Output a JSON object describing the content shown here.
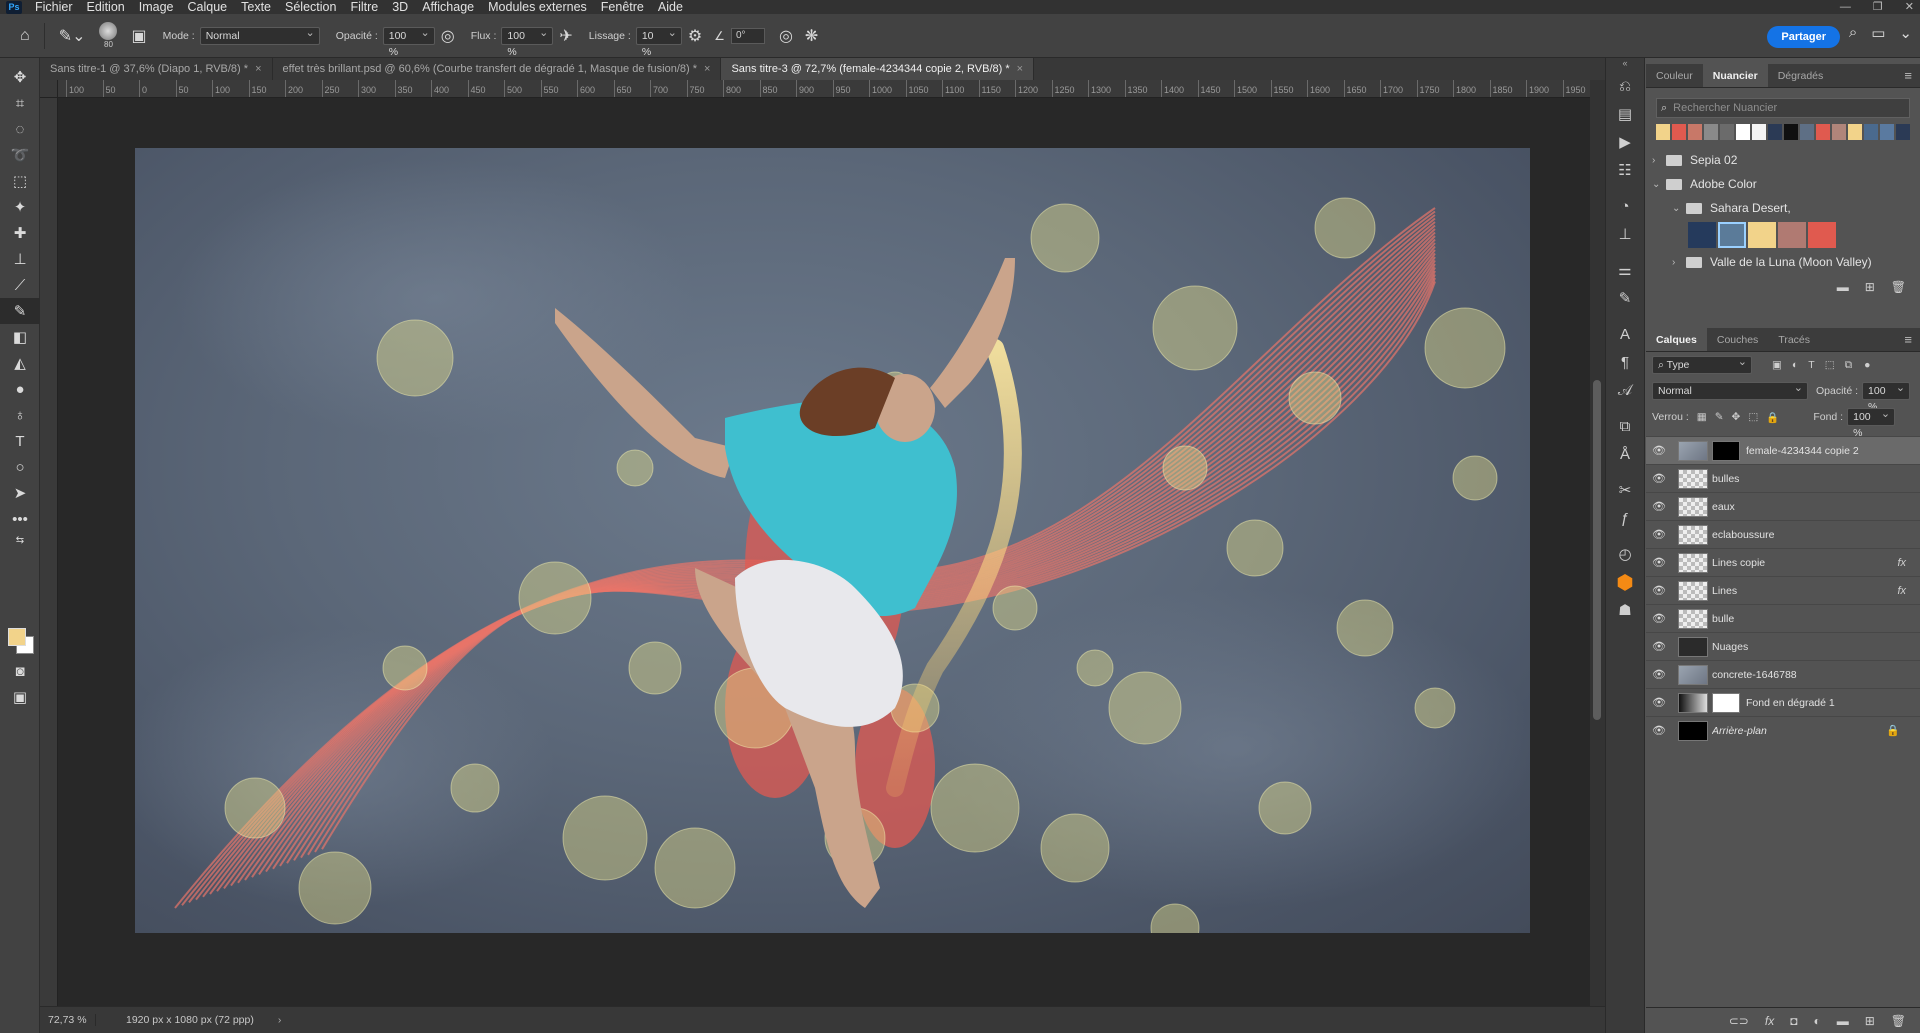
{
  "menu": [
    "Fichier",
    "Edition",
    "Image",
    "Calque",
    "Texte",
    "Sélection",
    "Filtre",
    "3D",
    "Affichage",
    "Modules externes",
    "Fenêtre",
    "Aide"
  ],
  "options": {
    "brush_size": "80",
    "mode_label": "Mode :",
    "mode_value": "Normal",
    "opacity_label": "Opacité :",
    "opacity_value": "100 %",
    "flow_label": "Flux :",
    "flow_value": "100 %",
    "smoothing_label": "Lissage :",
    "smoothing_value": "10 %",
    "angle_value": "0°",
    "share_label": "Partager"
  },
  "tabs": [
    {
      "label": "Sans titre-1 @ 37,6% (Diapo 1, RVB/8) *",
      "active": false
    },
    {
      "label": "effet très brillant.psd @ 60,6% (Courbe transfert de dégradé 1, Masque de fusion/8) *",
      "active": false
    },
    {
      "label": "Sans titre-3 @ 72,7% (female-4234344 copie 2, RVB/8) *",
      "active": true
    }
  ],
  "ruler_ticks": [
    "100",
    "50",
    "0",
    "50",
    "100",
    "150",
    "200",
    "250",
    "300",
    "350",
    "400",
    "450",
    "500",
    "550",
    "600",
    "650",
    "700",
    "750",
    "800",
    "850",
    "900",
    "950",
    "1000",
    "1050",
    "1100",
    "1150",
    "1200",
    "1250",
    "1300",
    "1350",
    "1400",
    "1450",
    "1500",
    "1550",
    "1600",
    "1650",
    "1700",
    "1750",
    "1800",
    "1850",
    "1900",
    "1950"
  ],
  "status": {
    "zoom": "72,73 %",
    "dimensions": "1920 px x 1080 px (72 ppp)"
  },
  "swatches_panel": {
    "tabs": [
      "Couleur",
      "Nuancier",
      "Dégradés"
    ],
    "active_tab": "Nuancier",
    "search_placeholder": "Rechercher Nuancier",
    "recent_colors": [
      "#f2d38a",
      "#e05a4f",
      "#c87868",
      "#8a8a8a",
      "#6b6b6b",
      "#ffffff",
      "#f4f4f4",
      "#2b3a55",
      "#101010",
      "#5e6f85",
      "#e05a4f",
      "#b0857a",
      "#f2d38a",
      "#4a6a8e",
      "#5a7aa0",
      "#2b3a55"
    ],
    "folders": [
      {
        "label": "Sepia 02",
        "expanded": false
      },
      {
        "label": "Adobe Color",
        "expanded": true
      },
      {
        "label": "Sahara Desert,",
        "expanded": true
      },
      {
        "label": "Valle de la Luna (Moon Valley)",
        "expanded": false
      }
    ],
    "sahara_colors": [
      "#253a5c",
      "#5b7b99",
      "#f2d38a",
      "#b07a72",
      "#e05a4f"
    ]
  },
  "layers_panel": {
    "tabs": [
      "Calques",
      "Couches",
      "Tracés"
    ],
    "active_tab": "Calques",
    "filter_value": "Type",
    "blend_value": "Normal",
    "opacity_label": "Opacité :",
    "opacity_value": "100 %",
    "lock_label": "Verrou :",
    "fill_label": "Fond :",
    "fill_value": "100 %",
    "layers": [
      {
        "name": "female-4234344 copie 2",
        "active": true
      },
      {
        "name": "bulles"
      },
      {
        "name": "eaux"
      },
      {
        "name": "eclaboussure"
      },
      {
        "name": "Lines copie",
        "fx": "fx"
      },
      {
        "name": "Lines",
        "fx": "fx"
      },
      {
        "name": "bulle"
      },
      {
        "name": "Nuages"
      },
      {
        "name": "concrete-1646788"
      },
      {
        "name": "Fond en dégradé 1"
      },
      {
        "name": "Arrière-plan",
        "locked": true
      }
    ]
  },
  "colors": {
    "accent": "#1473e6",
    "bubble": "#e6e08a",
    "ribbon": "#e8756a",
    "backdrop": "#5b6778"
  }
}
